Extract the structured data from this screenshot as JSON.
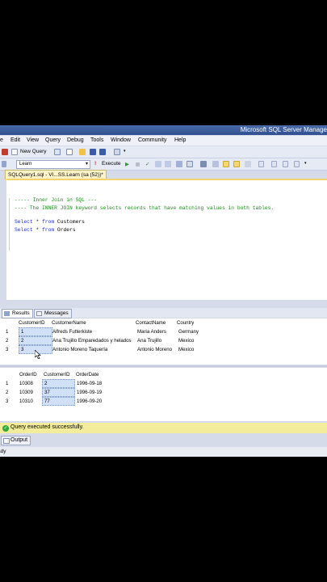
{
  "window": {
    "title": "Microsoft SQL Server Manage"
  },
  "menu": [
    "e",
    "Edit",
    "View",
    "Query",
    "Debug",
    "Tools",
    "Window",
    "Community",
    "Help"
  ],
  "toolbar1": {
    "new_query_label": "New Query"
  },
  "toolbar2": {
    "database": "Learn",
    "execute_label": "Execute"
  },
  "editor_tab": {
    "label": "SQLQuery1.sql - VI...SS.Learn (sa (52))*"
  },
  "editor": {
    "line1": "----- Inner Join in SQL ---",
    "line2": "---- The INNER JOIN keyword selects records that have matching values in both tables.",
    "line3_kw1": "Select",
    "line3_rest": " * ",
    "line3_kw2": "from",
    "line3_obj": " Customers",
    "line4_kw1": "Select",
    "line4_rest": " * ",
    "line4_kw2": "from",
    "line4_obj": " Orders"
  },
  "results_tabs": {
    "results": "Results",
    "messages": "Messages"
  },
  "grid1": {
    "columns": [
      "CustomerID",
      "CustomerName",
      "ContactName",
      "Country"
    ],
    "rows": [
      {
        "n": "1",
        "id": "1",
        "name": "Alfreds Futterkiste",
        "contact": "Maria Anders",
        "country": "Germany"
      },
      {
        "n": "2",
        "id": "2",
        "name": "Ana Trujillo Emparedados y helados",
        "contact": "Ana Trujillo",
        "country": "Mexico"
      },
      {
        "n": "3",
        "id": "3",
        "name": "Antonio Moreno Taquería",
        "contact": "Antonio Moreno",
        "country": "Mexico"
      }
    ]
  },
  "grid2": {
    "columns": [
      "OrderID",
      "CustomerID",
      "OrderDate"
    ],
    "rows": [
      {
        "n": "1",
        "order": "10308",
        "cust": "2",
        "date": "1996-09-18"
      },
      {
        "n": "2",
        "order": "10309",
        "cust": "37",
        "date": "1996-09-19"
      },
      {
        "n": "3",
        "order": "10310",
        "cust": "77",
        "date": "1996-09-20"
      }
    ]
  },
  "status": {
    "message": "Query executed successfully."
  },
  "output": {
    "label": "Output"
  },
  "ready": {
    "label": "ady"
  }
}
